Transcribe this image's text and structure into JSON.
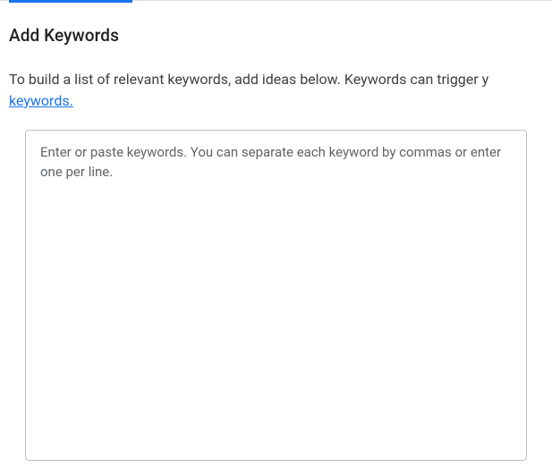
{
  "header": {
    "title": "Add Keywords"
  },
  "description": {
    "text_prefix": "To build a list of relevant keywords, add ideas below. Keywords can trigger y",
    "link_text": "keywords."
  },
  "form": {
    "keywords_placeholder": "Enter or paste keywords. You can separate each keyword by commas or enter one per line.",
    "keywords_value": ""
  }
}
